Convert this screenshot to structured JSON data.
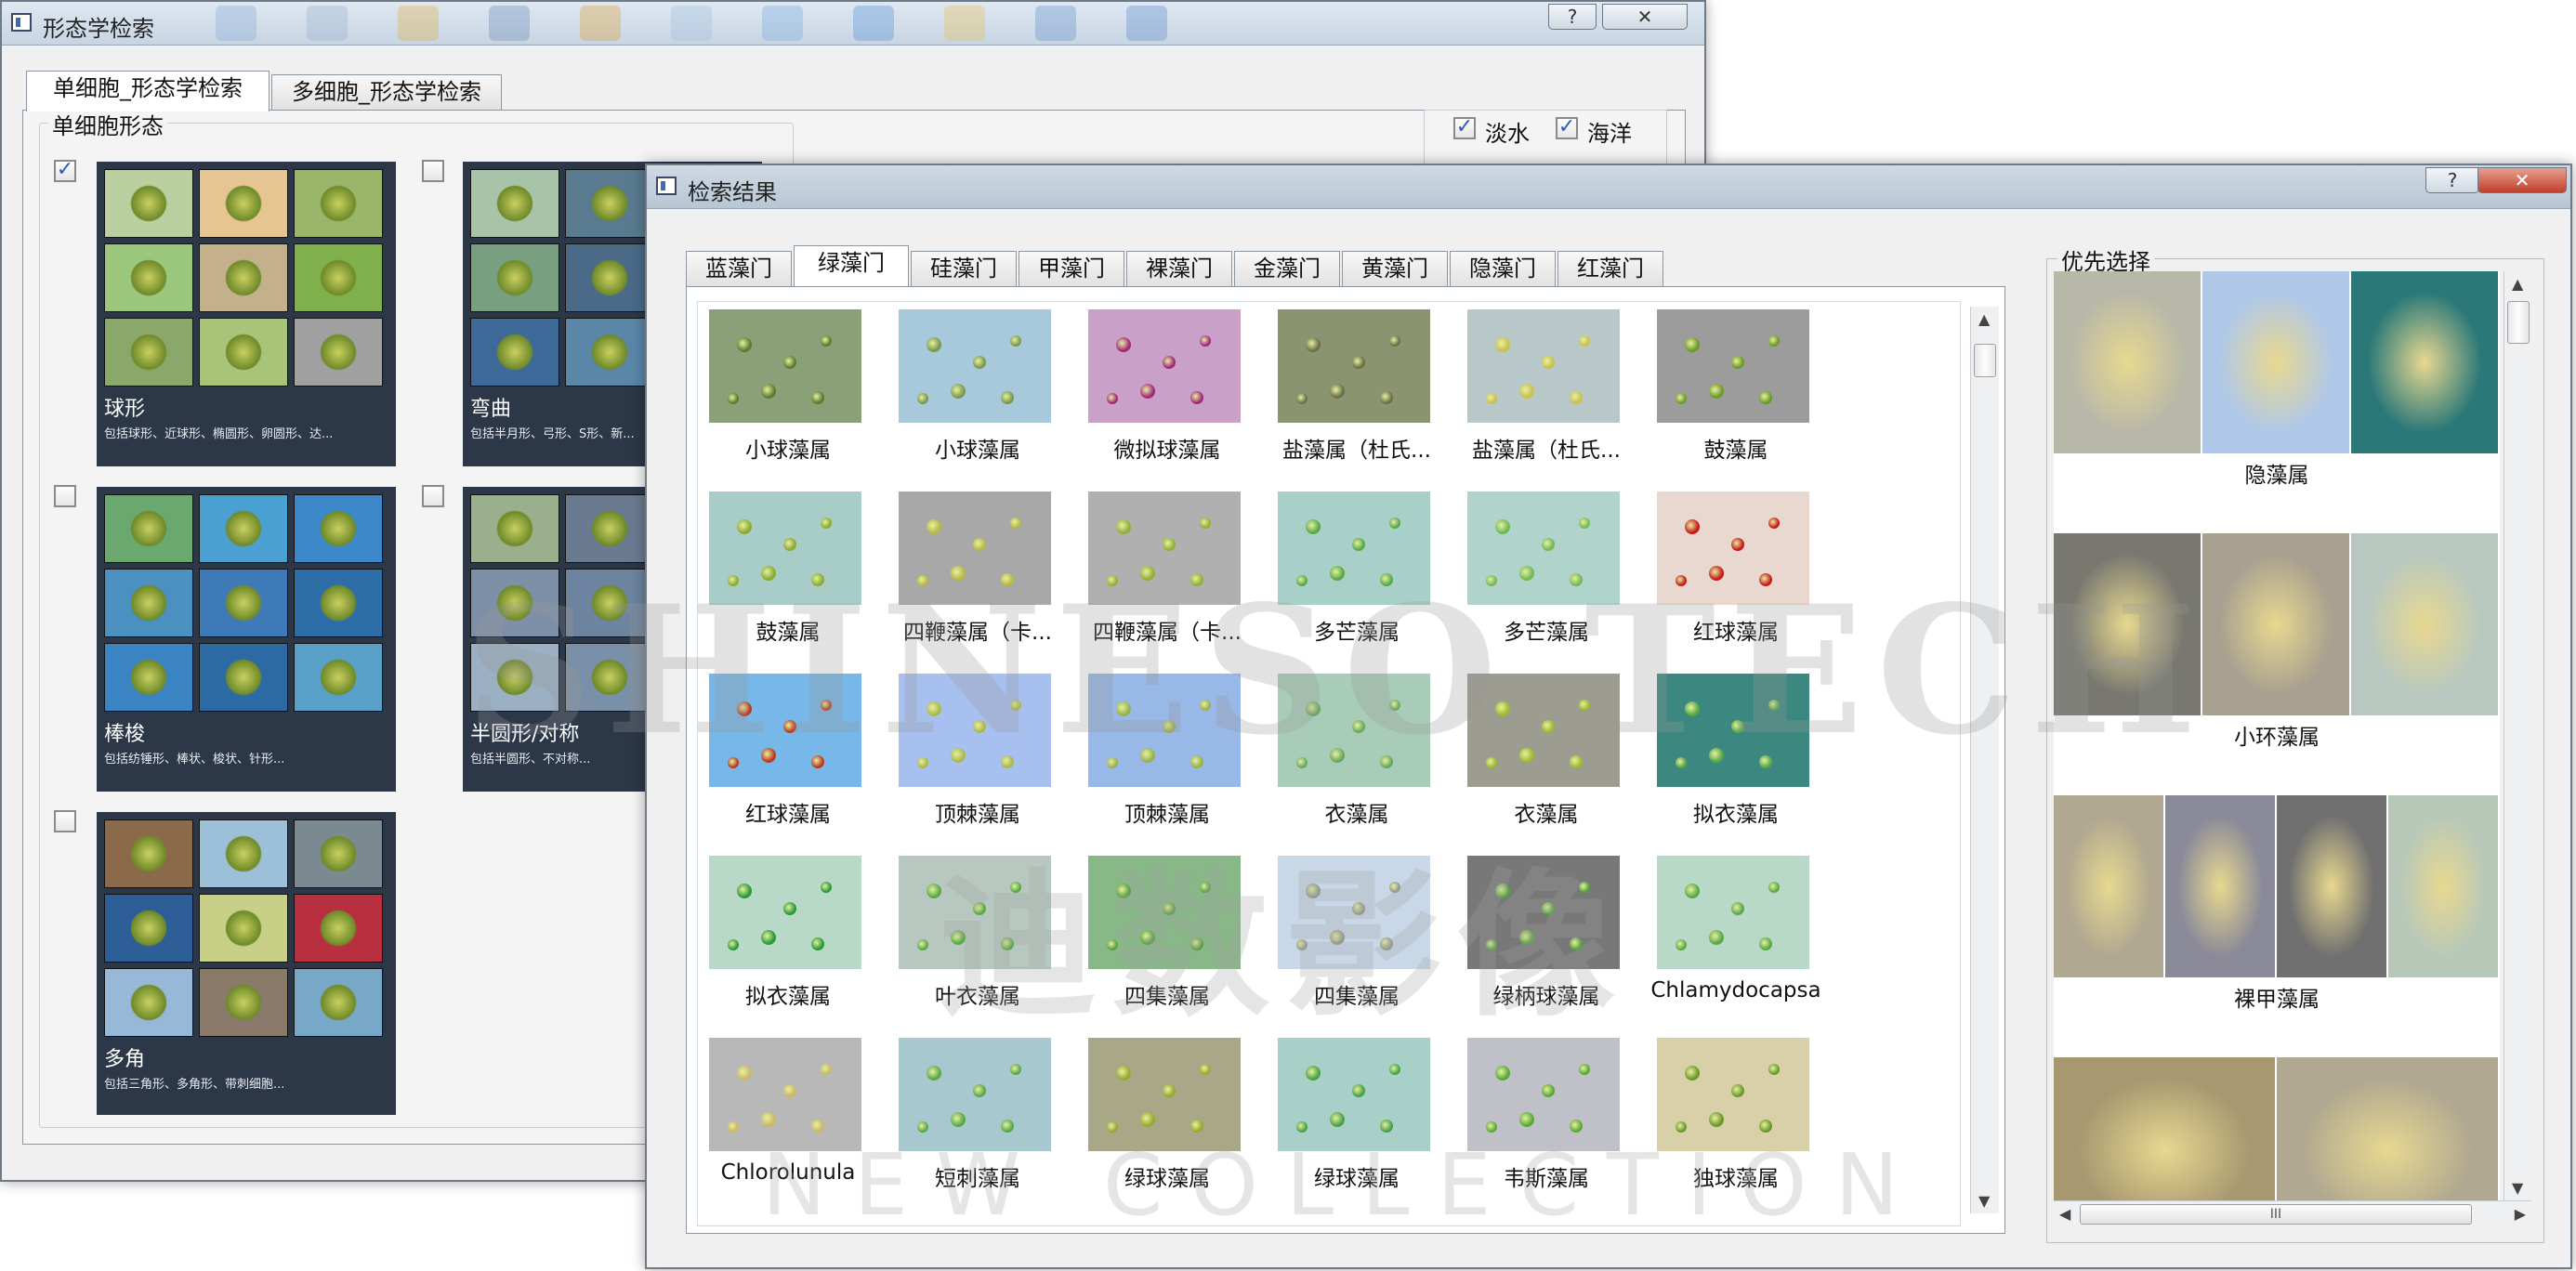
{
  "back_window": {
    "title": "形态学检索",
    "help_label": "?",
    "close_label": "✕",
    "tabs": [
      "单细胞_形态学检索",
      "多细胞_形态学检索"
    ],
    "group_label": "单细胞形态",
    "filters": [
      {
        "label": "淡水",
        "checked": true
      },
      {
        "label": "海洋",
        "checked": true
      }
    ],
    "cards": [
      {
        "name": "球形",
        "desc": "包括球形、近球形、椭圆形、卵圆形、达...",
        "checked": true,
        "colors": [
          "#b9cfa0",
          "#e6c592",
          "#98b56a",
          "#9bc77c",
          "#c4b08a",
          "#7fb04c",
          "#8aa86a",
          "#a8c478",
          "#a0a0a0"
        ]
      },
      {
        "name": "弯曲",
        "desc": "包括半月形、弓形、S形、新...",
        "checked": false,
        "colors": [
          "#a8c4a8",
          "#5a7a90",
          "#7fa0b8",
          "#78a080",
          "#4a6a88",
          "#6e8c70",
          "#3d6a98",
          "#5a86a8",
          "#7090a0"
        ]
      },
      {
        "name": "棒梭",
        "desc": "包括纺锤形、棒状、梭状、针形...",
        "checked": false,
        "colors": [
          "#6aa870",
          "#4aa0d0",
          "#3c88c8",
          "#4a90c0",
          "#3e7ab8",
          "#2e6ea8",
          "#3a84c4",
          "#2c6aa4",
          "#58a0c8"
        ]
      },
      {
        "name": "半圆形/对称",
        "desc": "包括半圆形、不对称...",
        "checked": false,
        "colors": [
          "#9ab08c",
          "#6a7a90",
          "#8a9cb0",
          "#7e90a8",
          "#6c84a0",
          "#8aa0b8",
          "#9cb0c4",
          "#7a90a8",
          "#8aa4bc"
        ]
      },
      {
        "name": "多角",
        "desc": "包括三角形、多角形、带刺细胞...",
        "checked": false,
        "colors": [
          "#8a6a48",
          "#9cc0d8",
          "#7a8a90",
          "#2e5e98",
          "#c8d088",
          "#b83040",
          "#98b8d8",
          "#8a7a6a",
          "#78a8c8"
        ]
      }
    ]
  },
  "front_window": {
    "title": "检索结果",
    "help_label": "?",
    "close_label": "✕",
    "tabs": [
      "蓝藻门",
      "绿藻门",
      "硅藻门",
      "甲藻门",
      "裸藻门",
      "金藻门",
      "黄藻门",
      "隐藻门",
      "红藻门"
    ],
    "active_tab": 1,
    "results": [
      {
        "label": "小球藻属",
        "bg": "#8aa078",
        "dot": "#5a7a30"
      },
      {
        "label": "小球藻属",
        "bg": "#a8c8dc",
        "dot": "#7a9850"
      },
      {
        "label": "微拟球藻属",
        "bg": "#c8a0c8",
        "dot": "#a02878"
      },
      {
        "label": "盐藻属（杜氏...",
        "bg": "#8a9470",
        "dot": "#6a7048"
      },
      {
        "label": "盐藻属（杜氏...",
        "bg": "#b8c8c8",
        "dot": "#c8c050"
      },
      {
        "label": "鼓藻属",
        "bg": "#9c9c9c",
        "dot": "#6a9a28"
      },
      {
        "label": "鼓藻属",
        "bg": "#a8ccc8",
        "dot": "#8aaa30"
      },
      {
        "label": "四鞭藻属（卡...",
        "bg": "#a8a8a8",
        "dot": "#b8b848"
      },
      {
        "label": "四鞭藻属（卡...",
        "bg": "#b0b0b0",
        "dot": "#90b038"
      },
      {
        "label": "多芒藻属",
        "bg": "#a8d0c8",
        "dot": "#58a848"
      },
      {
        "label": "多芒藻属",
        "bg": "#b0d4cc",
        "dot": "#70b858"
      },
      {
        "label": "红球藻属",
        "bg": "#e8d8d0",
        "dot": "#c81818"
      },
      {
        "label": "红球藻属",
        "bg": "#78b8e8",
        "dot": "#b83820"
      },
      {
        "label": "顶棘藻属",
        "bg": "#a8c0f0",
        "dot": "#a8b850"
      },
      {
        "label": "顶棘藻属",
        "bg": "#98b8e8",
        "dot": "#98b050"
      },
      {
        "label": "衣藻属",
        "bg": "#a8ccb8",
        "dot": "#68a860"
      },
      {
        "label": "衣藻属",
        "bg": "#9c9c90",
        "dot": "#a0b830"
      },
      {
        "label": "拟衣藻属",
        "bg": "#3c8880",
        "dot": "#58a848"
      },
      {
        "label": "拟衣藻属",
        "bg": "#b8d8c8",
        "dot": "#289838"
      },
      {
        "label": "叶衣藻属",
        "bg": "#b8c8c0",
        "dot": "#58a848"
      },
      {
        "label": "四集藻属",
        "bg": "#88b888",
        "dot": "#58a040"
      },
      {
        "label": "四集藻属",
        "bg": "#c8d8e8",
        "dot": "#909890"
      },
      {
        "label": "绿柄球藻属",
        "bg": "#787878",
        "dot": "#58a040"
      },
      {
        "label": "Chlamydocapsa",
        "bg": "#b8d8c8",
        "dot": "#58a848"
      },
      {
        "label": "Chlorolunula",
        "bg": "#b8b8b8",
        "dot": "#c8b868"
      },
      {
        "label": "短刺藻属",
        "bg": "#a8c8d0",
        "dot": "#58a848"
      },
      {
        "label": "绿球藻属",
        "bg": "#a8a888",
        "dot": "#98a830"
      },
      {
        "label": "绿球藻属",
        "bg": "#a8d0c8",
        "dot": "#48a048"
      },
      {
        "label": "韦斯藻属",
        "bg": "#c0c0c8",
        "dot": "#58a838"
      },
      {
        "label": "独球藻属",
        "bg": "#d8d0a8",
        "dot": "#6a9828"
      }
    ],
    "priority_label": "优先选择",
    "priority": [
      {
        "label": "隐藻属",
        "panels": [
          "#b8b8a8",
          "#b0c8e8",
          "#2a7878"
        ]
      },
      {
        "label": "小环藻属",
        "panels": [
          "#787870",
          "#a8a090",
          "#b8c8c0"
        ]
      },
      {
        "label": "裸甲藻属",
        "panels": [
          "#b0a890",
          "#8a8a98",
          "#707070",
          "#b8c8b8"
        ]
      },
      {
        "label": "",
        "panels": [
          "#a89870",
          "#b0a890"
        ]
      }
    ],
    "hscroll_grip": "III"
  },
  "watermark": {
    "line1": "SHINESO TECH",
    "line2": "迪数影像",
    "line3": "NEW COLLECTION"
  }
}
